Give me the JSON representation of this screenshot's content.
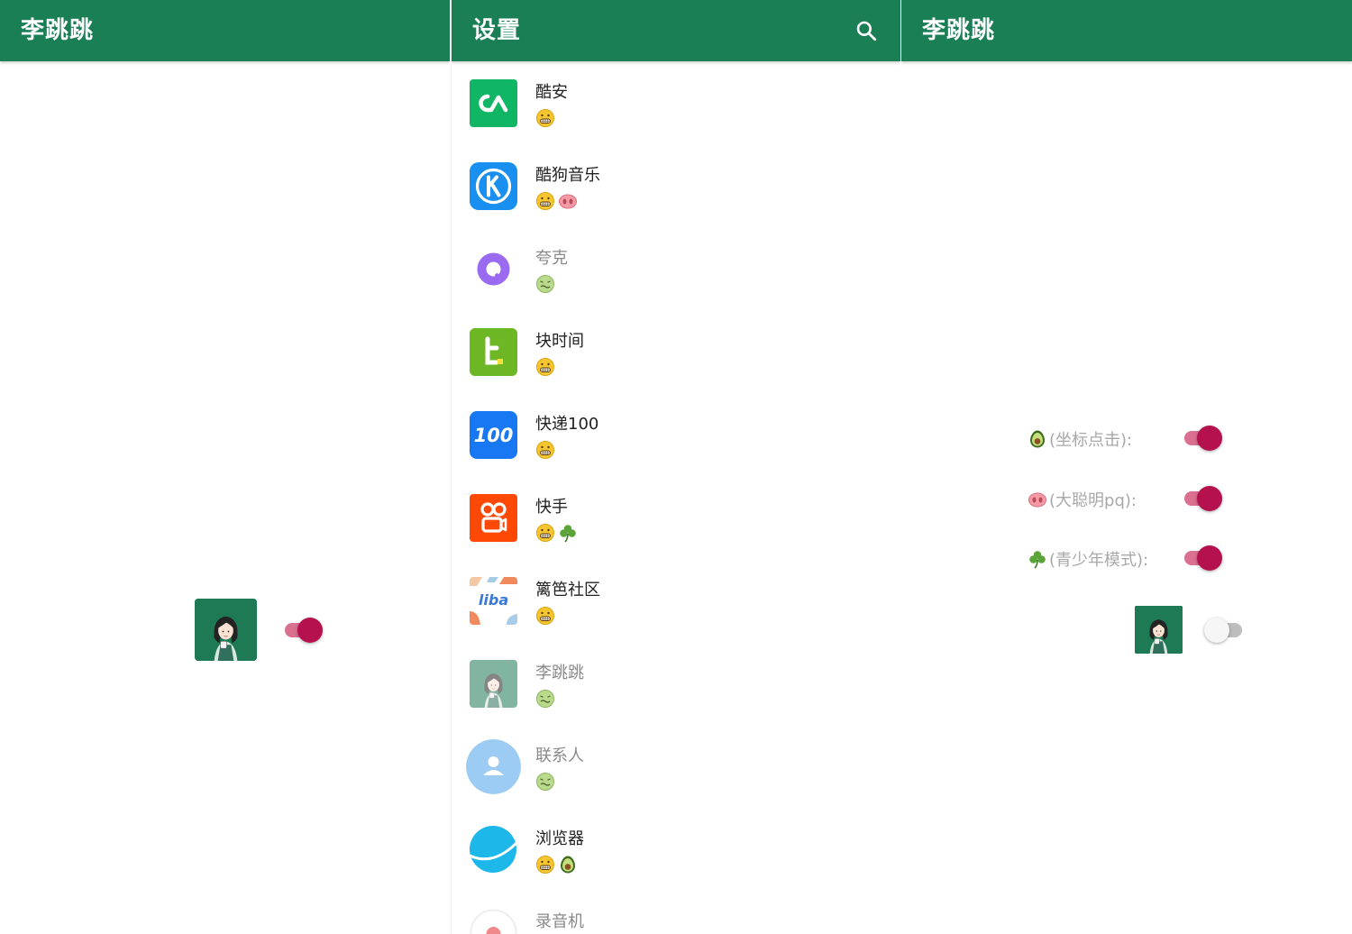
{
  "left": {
    "title": "李跳跳",
    "master_switch_on": true
  },
  "middle": {
    "title": "设置",
    "apps": [
      {
        "name": "酷安",
        "badges": [
          "grimace-face"
        ],
        "enabled": true,
        "icon": "coolapk-icon"
      },
      {
        "name": "酷狗音乐",
        "badges": [
          "grimace-face",
          "pig-nose"
        ],
        "enabled": true,
        "icon": "kugou-icon"
      },
      {
        "name": "夸克",
        "badges": [
          "nauseated-face"
        ],
        "enabled": false,
        "icon": "quark-icon"
      },
      {
        "name": "块时间",
        "badges": [
          "grimace-face"
        ],
        "enabled": true,
        "icon": "kuaishijian-icon"
      },
      {
        "name": "快递100",
        "badges": [
          "grimace-face"
        ],
        "enabled": true,
        "icon": "kuaidi100-icon"
      },
      {
        "name": "快手",
        "badges": [
          "grimace-face",
          "shamrock"
        ],
        "enabled": true,
        "icon": "kuaishou-icon"
      },
      {
        "name": "篱笆社区",
        "badges": [
          "grimace-face"
        ],
        "enabled": true,
        "icon": "liba-icon"
      },
      {
        "name": "李跳跳",
        "badges": [
          "nauseated-face"
        ],
        "enabled": false,
        "icon": "litiaotiao-icon"
      },
      {
        "name": "联系人",
        "badges": [
          "nauseated-face"
        ],
        "enabled": false,
        "icon": "contacts-icon"
      },
      {
        "name": "浏览器",
        "badges": [
          "grimace-face",
          "avocado"
        ],
        "enabled": true,
        "icon": "browser-icon"
      },
      {
        "name": "录音机",
        "badges": [],
        "enabled": false,
        "icon": "recorder-icon"
      }
    ]
  },
  "right": {
    "title": "李跳跳",
    "rules": [
      {
        "emoji": "avocado",
        "label": "(坐标点击):",
        "on": true
      },
      {
        "emoji": "pig-nose",
        "label": "(大聪明pq):",
        "on": true
      },
      {
        "emoji": "shamrock",
        "label": "(青少年模式):",
        "on": true
      }
    ],
    "app_switch_on": false
  },
  "colors": {
    "appbar": "#1b7f56",
    "switch_thumb_on": "#b5114f",
    "switch_track_on": "#d9708f"
  }
}
